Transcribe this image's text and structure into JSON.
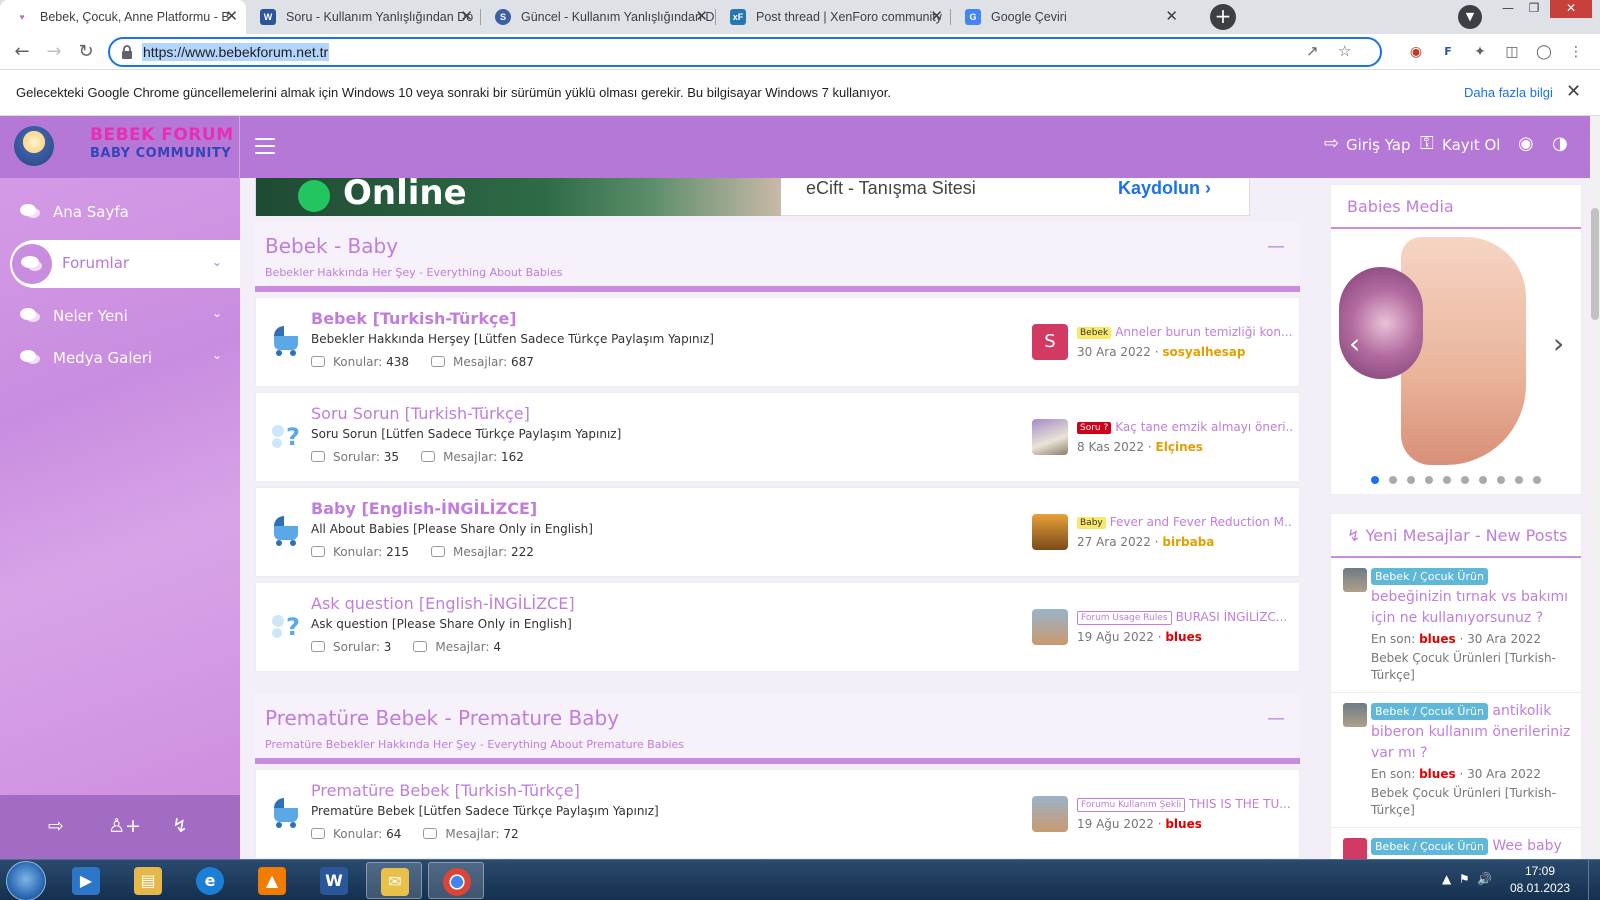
{
  "browser": {
    "tabs": [
      {
        "title": "Bebek, Çocuk, Anne Platformu - B",
        "icon": "forum-favicon",
        "color": "#b678d6"
      },
      {
        "title": "Soru - Kullanım Yanlışlığından Do",
        "icon": "word-favicon",
        "color": "#2b579a"
      },
      {
        "title": "Güncel - Kullanım Yanlışlığından D",
        "icon": "sozluk-favicon",
        "color": "#3d5fa8"
      },
      {
        "title": "Post thread | XenForo community",
        "icon": "xenforo-favicon",
        "color": "#2577b1"
      },
      {
        "title": "Google Çeviri",
        "icon": "google-translate-favicon",
        "color": "#4285f4"
      }
    ],
    "url": "https://www.bebekforum.net.tr",
    "infobar": {
      "message": "Gelecekteki Google Chrome güncellemelerini almak için Windows 10 veya sonraki bir sürümün yüklü olması gerekir. Bu bilgisayar Windows 7 kullanıyor.",
      "link": "Daha fazla bilgi"
    }
  },
  "site": {
    "brand_line1": "BEBEK FORUM",
    "brand_line2": "BABY COMMUNITY",
    "login": "Giriş Yap",
    "register": "Kayıt Ol"
  },
  "sidebar": {
    "items": [
      {
        "label": "Ana Sayfa"
      },
      {
        "label": "Forumlar"
      },
      {
        "label": "Neler Yeni"
      },
      {
        "label": "Medya Galeri"
      }
    ]
  },
  "banner": {
    "status": "Online",
    "ad_text": "eCift - Tanışma Sitesi",
    "ad_cta": "Kaydolun"
  },
  "categories": [
    {
      "title": "Bebek - Baby",
      "subtitle": "Bebekler Hakkında Her Şey - Everything About Babies",
      "nodes": [
        {
          "title": "Bebek [Turkish-Türkçe]",
          "desc": "Bebekler Hakkında Herşey [Lütfen Sadece Türkçe Paylaşım Yapınız]",
          "stat1_label": "Konular:",
          "stat1": "438",
          "stat2_label": "Mesajlar:",
          "stat2": "687",
          "prefix": "Bebek",
          "last_title": "Anneler burun temizliği kon...",
          "date": "30 Ara 2022",
          "user": "sosyalhesap",
          "avatar": "S"
        },
        {
          "title": "Soru Sorun [Turkish-Türkçe]",
          "desc": "Soru Sorun [Lütfen Sadece Türkçe Paylaşım Yapınız]",
          "stat1_label": "Sorular:",
          "stat1": "35",
          "stat2_label": "Mesajlar:",
          "stat2": "162",
          "prefix": "Soru ?",
          "last_title": "Kaç tane emzik almayı öneri...",
          "date": "8 Kas 2022",
          "user": "Elçines",
          "avatar": ""
        },
        {
          "title": "Baby [English-İNGİLİZCE]",
          "desc": "All About Babies [Please Share Only in English]",
          "stat1_label": "Konular:",
          "stat1": "215",
          "stat2_label": "Mesajlar:",
          "stat2": "222",
          "prefix": "Baby",
          "last_title": "Fever and Fever Reduction M...",
          "date": "27 Ara 2022",
          "user": "birbaba",
          "avatar": ""
        },
        {
          "title": "Ask question [English-İNGİLİZCE]",
          "desc": "Ask question [Please Share Only in English]",
          "stat1_label": "Sorular:",
          "stat1": "3",
          "stat2_label": "Mesajlar:",
          "stat2": "4",
          "prefix": "Forum Usage Rules",
          "last_title": "BURASI İNGİLİZC...",
          "date": "19 Ağu 2022",
          "user": "blues",
          "avatar": ""
        }
      ]
    },
    {
      "title": "Prematüre Bebek - Premature Baby",
      "subtitle": "Prematüre Bebekler Hakkında Her Şey - Everything About Premature Babies",
      "nodes": [
        {
          "title": "Prematüre Bebek [Turkish-Türkçe]",
          "desc": "Prematüre Bebek [Lütfen Sadece Türkçe Paylaşım Yapınız]",
          "stat1_label": "Konular:",
          "stat1": "64",
          "stat2_label": "Mesajlar:",
          "stat2": "72",
          "prefix": "Forumu Kullanım Şekli",
          "last_title": "THIS IS THE TU...",
          "date": "19 Ağu 2022",
          "user": "blues",
          "avatar": ""
        }
      ]
    }
  ],
  "right": {
    "media_title": "Babies Media",
    "slide_count": 10,
    "active_slide": 1,
    "new_posts_title": "Yeni Mesajlar - New Posts",
    "posts": [
      {
        "badge": "Bebek / Çocuk Ürün",
        "title": "bebeğinizin tırnak vs bakımı için ne kullanıyorsunuz ?",
        "last_label": "En son:",
        "user": "blues",
        "date": "· 30 Ara 2022",
        "forum": "Bebek Çocuk Ürünleri [Turkish-Türkçe]"
      },
      {
        "badge": "Bebek / Çocuk Ürün",
        "title": "antikolik biberon kullanım önerileriniz var mı ?",
        "last_label": "En son:",
        "user": "blues",
        "date": "· 30 Ara 2022",
        "forum": "Bebek Çocuk Ürünleri [Turkish-Türkçe]"
      },
      {
        "badge": "Bebek / Çocuk Ürün",
        "title": "Wee baby",
        "last_label": "",
        "user": "",
        "date": "",
        "forum": ""
      }
    ]
  },
  "taskbar": {
    "time": "17:09",
    "date": "08.01.2023"
  },
  "colors": {
    "accent": "#b678d6",
    "link": "#c07ddc",
    "user_orange": "#e0a000",
    "user_red": "#e10000"
  }
}
